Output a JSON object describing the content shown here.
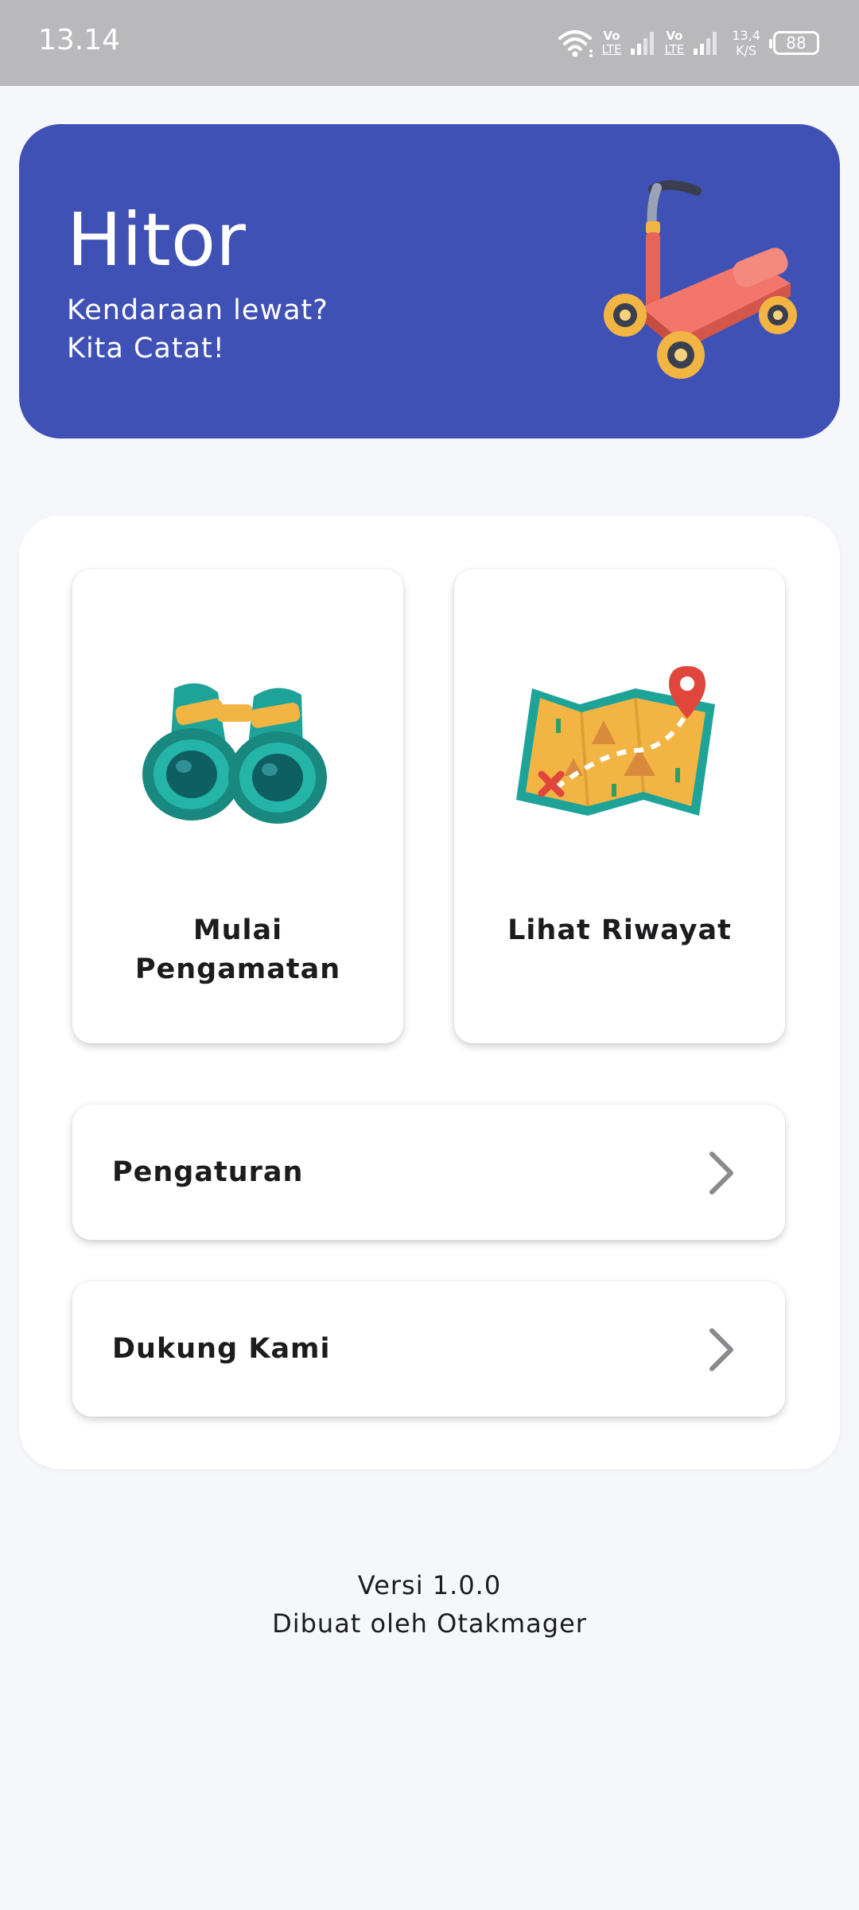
{
  "status_bar": {
    "time": "13.14",
    "volte_top": "Vo",
    "volte_bottom": "LTE",
    "net_speed_value": "13,4",
    "net_speed_unit": "K/S",
    "battery": "88",
    "icons": [
      "wifi-icon",
      "signal-icon",
      "signal-icon",
      "battery-icon"
    ]
  },
  "header": {
    "title": "Hitor",
    "subtitle_line1": "Kendaraan lewat?",
    "subtitle_line2": "Kita Catat!",
    "banner_color": "#3f51b5",
    "illustration": "kick-scooter-icon"
  },
  "menu": {
    "tiles": [
      {
        "label_line1": "Mulai",
        "label_line2": "Pengamatan",
        "icon": "binoculars-icon"
      },
      {
        "label": "Lihat Riwayat",
        "icon": "treasure-map-icon"
      }
    ],
    "rows": [
      {
        "label": "Pengaturan",
        "icon": "chevron-right-icon"
      },
      {
        "label": "Dukung Kami",
        "icon": "chevron-right-icon"
      }
    ]
  },
  "footer": {
    "version": "Versi 1.0.0",
    "credit": "Dibuat oleh Otakmager"
  }
}
